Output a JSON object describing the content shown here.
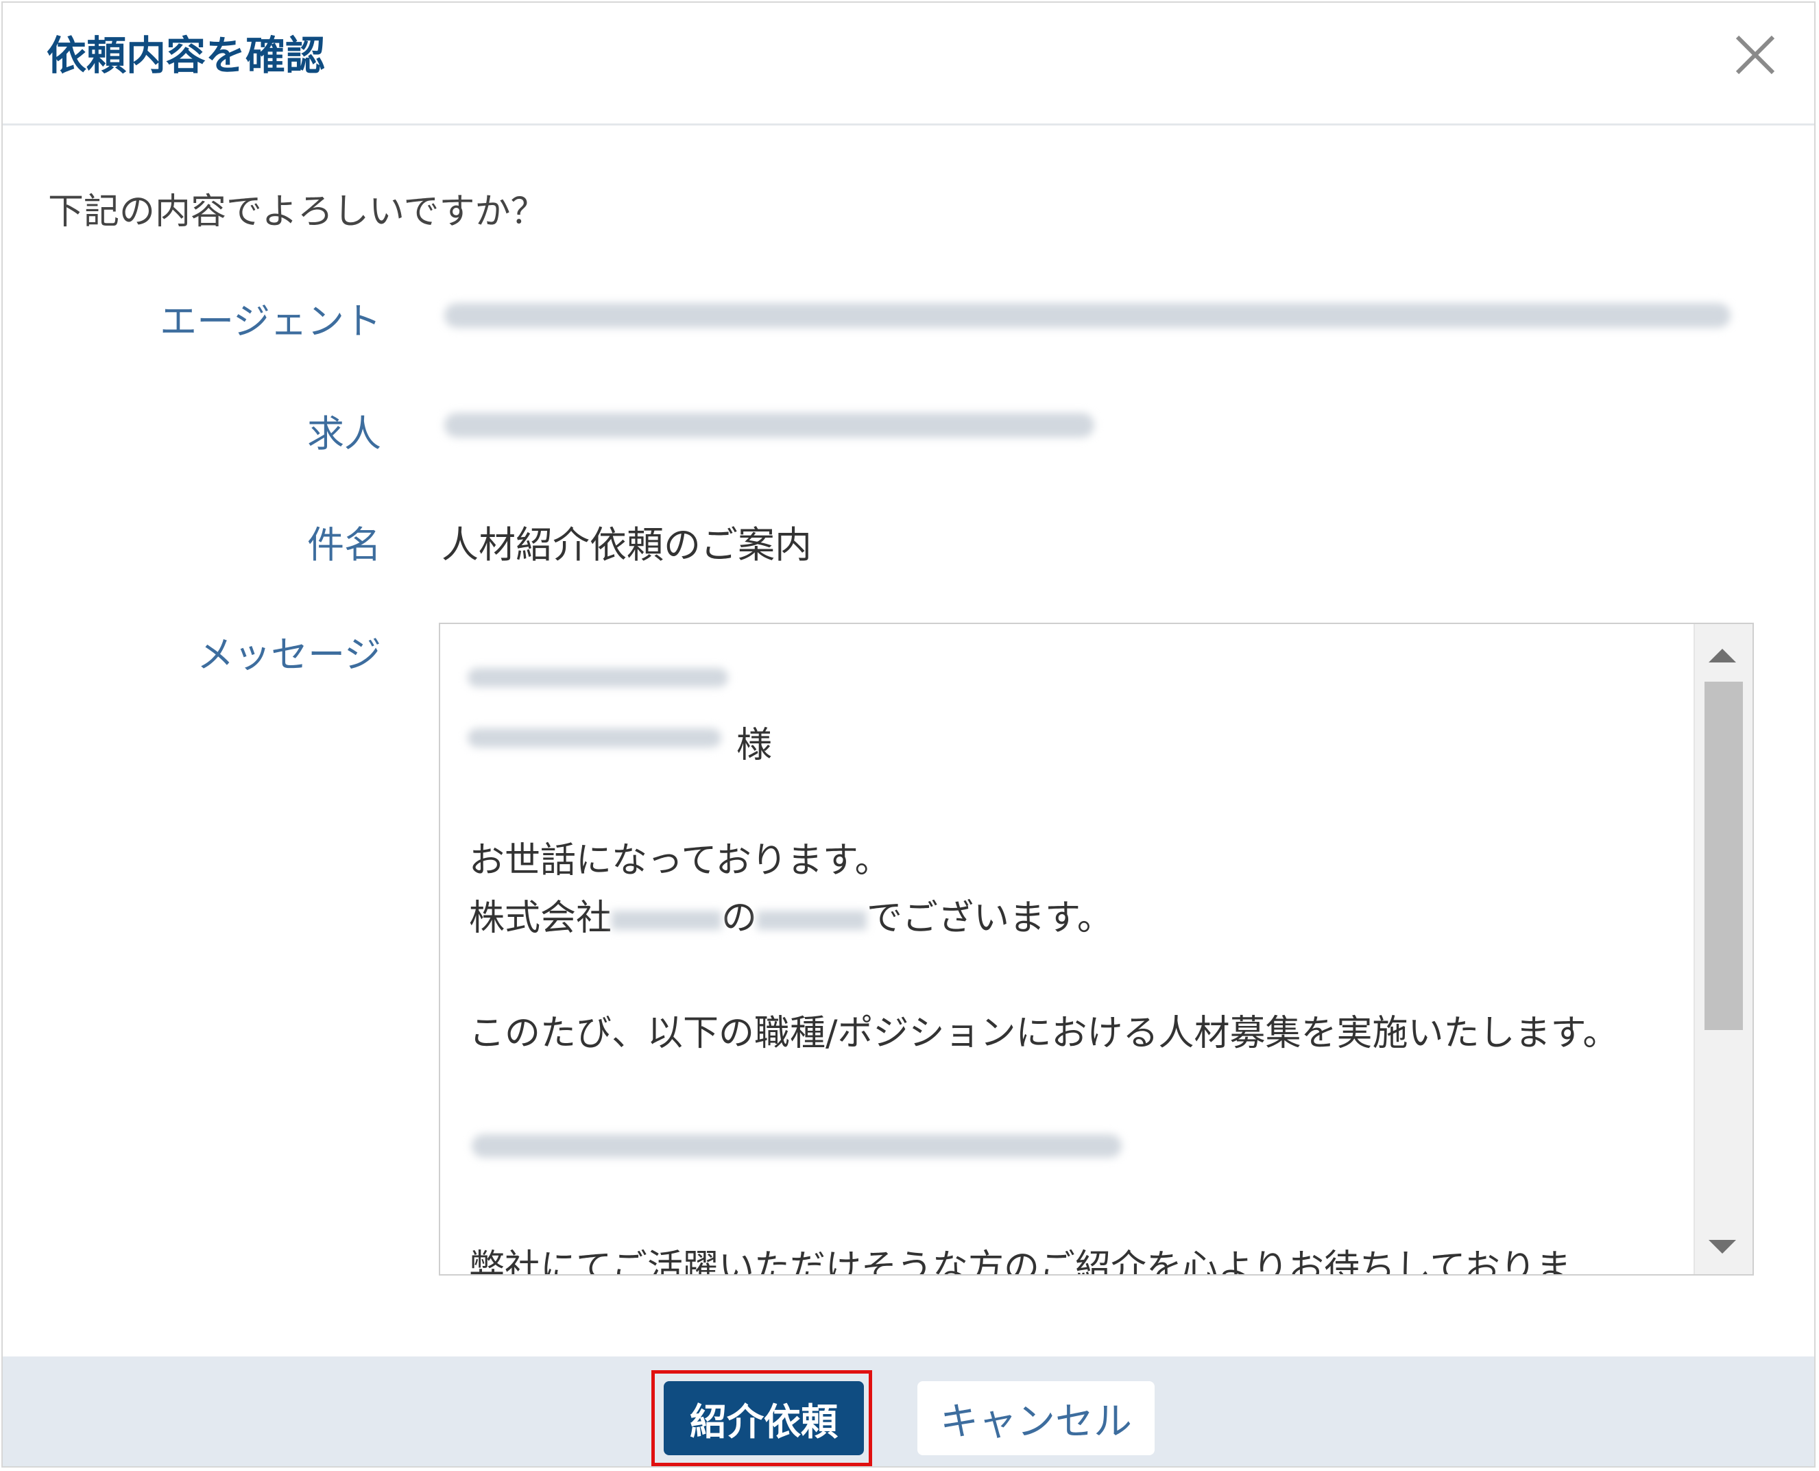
{
  "dialog": {
    "title": "依頼内容を確認",
    "close_icon": "close-icon"
  },
  "body": {
    "prompt": "下記の内容でよろしいですか？",
    "fields": {
      "agent_label": "エージェント",
      "job_label": "求人",
      "subject_label": "件名",
      "subject_value": "人材紹介依頼のご案内",
      "message_label": "メッセージ"
    },
    "message": {
      "honorific": "様",
      "greeting": "お世話になっております。",
      "company_prefix": "株式会社",
      "company_particle": "の",
      "company_suffix": "でございます。",
      "intro": "このたび、以下の職種/ポジションにおける人材募集を実施いたします。",
      "closing_partial": "弊社にてご活躍いただけそうな方のご紹介を心よりお待ちしておりま"
    }
  },
  "footer": {
    "submit_label": "紹介依頼",
    "cancel_label": "キャンセル",
    "highlight_color": "#e01010",
    "primary_color": "#0f4c81"
  }
}
